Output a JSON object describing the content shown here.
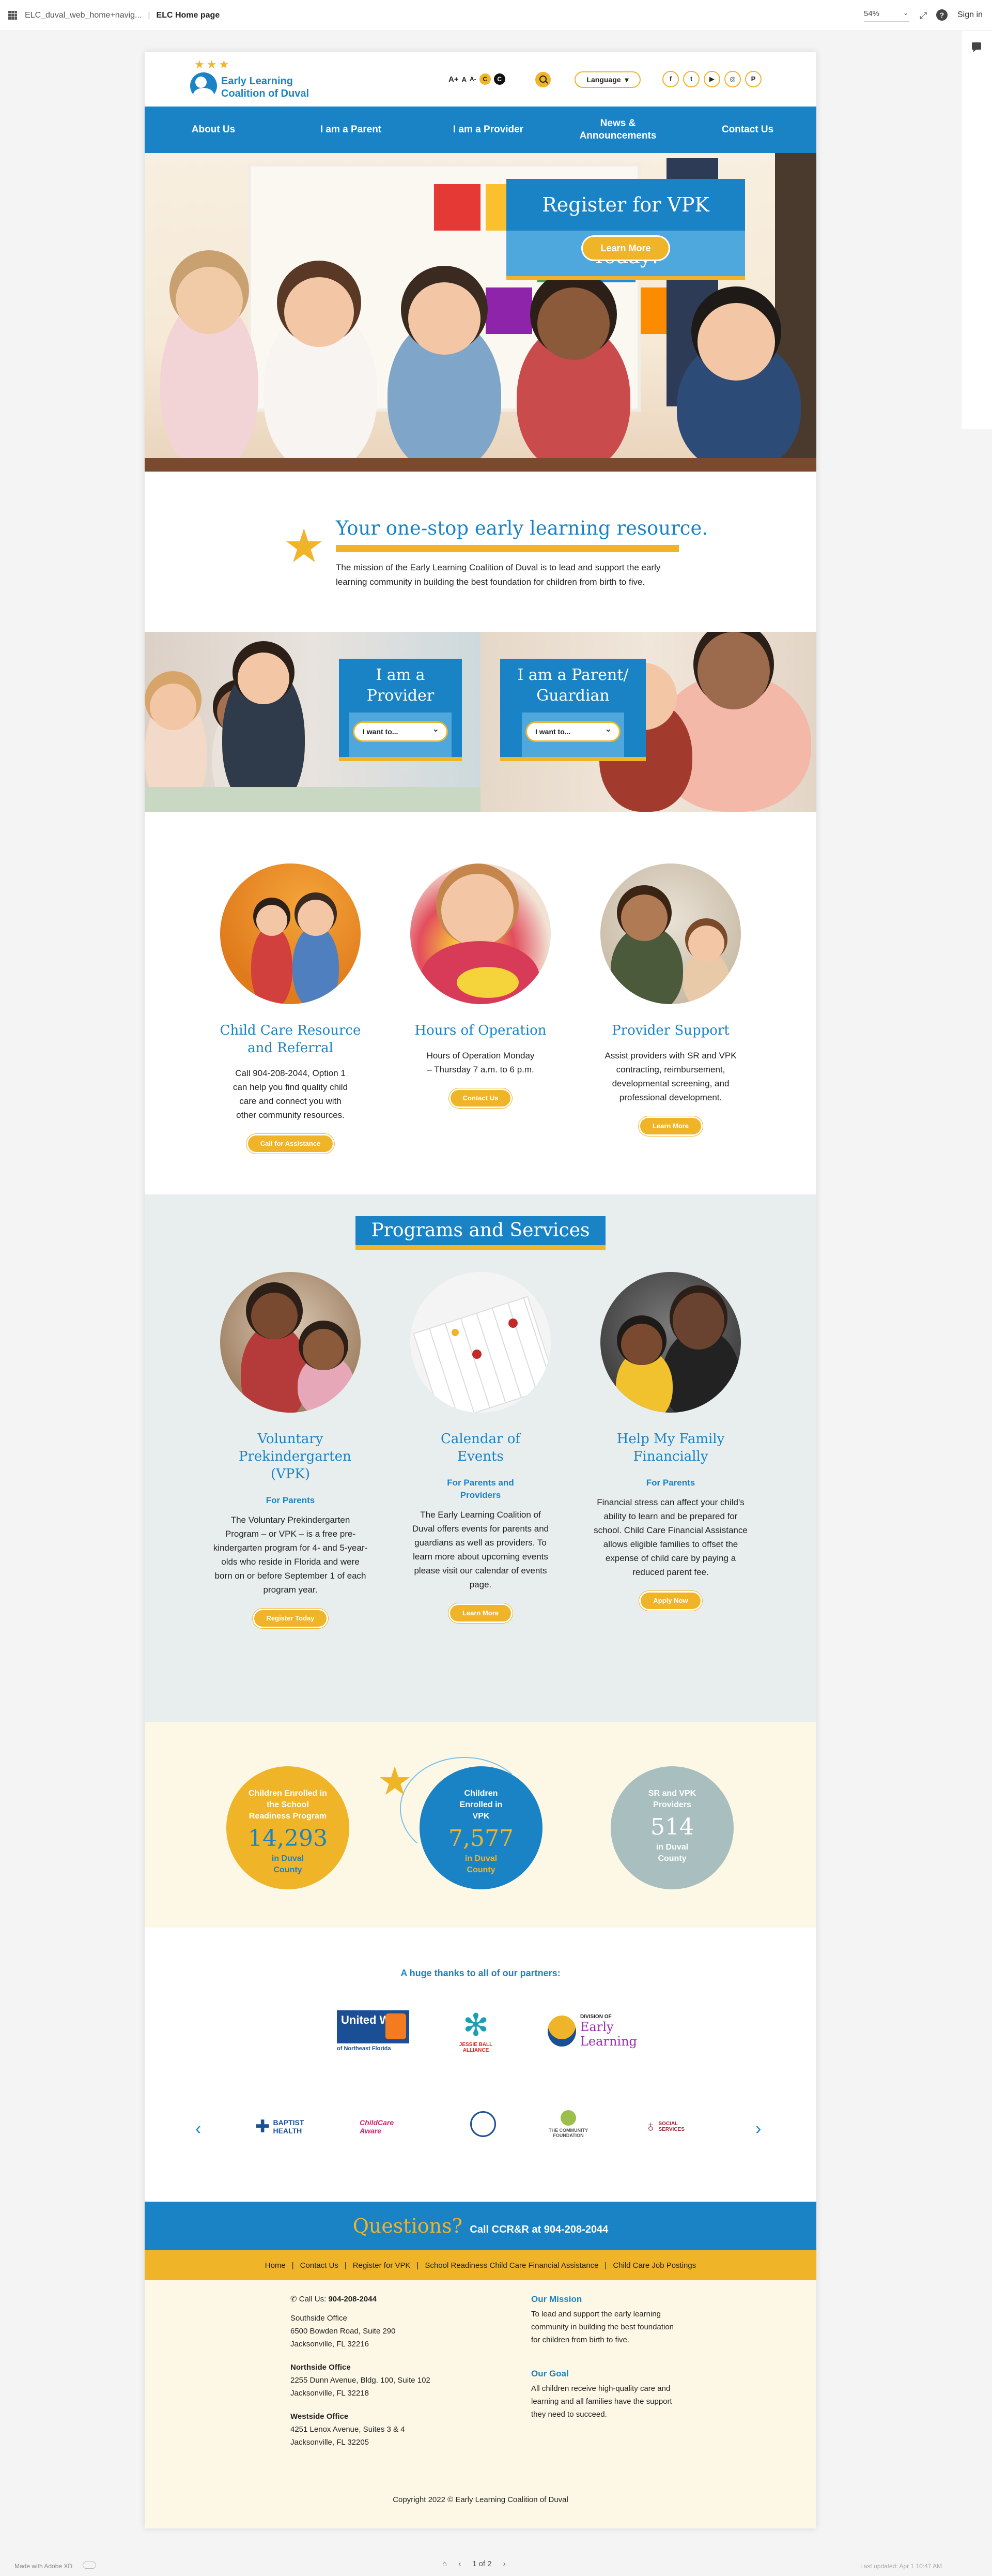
{
  "app": {
    "file_name": "ELC_duval_web_home+navig...",
    "page_name": "ELC Home page",
    "zoom": "54%",
    "sign_in": "Sign in",
    "made_with": "Made with Adobe XD",
    "pager": "1 of 2",
    "last_updated": "Last updated: Apr 1 10:47 AM"
  },
  "header": {
    "logo_line1": "Early Learning",
    "logo_line2": "Coalition of Duval",
    "text_sizes": [
      "A+",
      "A",
      "A-"
    ],
    "contrast": [
      "C",
      "C"
    ],
    "language_label": "Language",
    "social": [
      "f",
      "t",
      "▶",
      "◎",
      "P"
    ]
  },
  "nav": [
    "About Us",
    "I am a Parent",
    "I am a Provider",
    "News & Announcements",
    "Contact Us"
  ],
  "hero": {
    "title": "Register for VPK Today!",
    "button": "Learn More"
  },
  "resource": {
    "title": "Your one-stop early learning resource.",
    "text": "The mission of the Early Learning Coalition of Duval is to lead and support the early learning community in building the best foundation for children from birth to five."
  },
  "audience": {
    "provider_title": "I am a Provider",
    "parent_title": "I am a Parent/ Guardian",
    "select_placeholder": "I want to..."
  },
  "services": [
    {
      "title": "Child Care Resource and Referral",
      "text": "Call 904-208-2044, Option 1 can help you find quality child care and connect you with other community resources.",
      "button": "Call for Assistance"
    },
    {
      "title": "Hours of Operation",
      "text": "Hours of Operation Monday – Thursday 7 a.m. to 6 p.m.",
      "button": "Contact Us"
    },
    {
      "title": "Provider Support",
      "text": "Assist providers with SR and VPK contracting, reimbursement, developmental screening, and professional development.",
      "button": "Learn More"
    }
  ],
  "programs": {
    "title": "Programs and Services",
    "items": [
      {
        "title": "Voluntary Prekindergarten (VPK)",
        "sub": "For Parents",
        "text": "The Voluntary Prekindergarten Program – or VPK – is a free pre-kindergarten program for 4- and 5-year-olds who reside in Florida and were born on or before September 1 of each program year.",
        "button": "Register Today"
      },
      {
        "title": "Calendar of Events",
        "sub": "For Parents and Providers",
        "text": "The Early Learning Coalition of Duval offers events for parents and guardians as well as providers. To learn more about upcoming events please visit our calendar of events page.",
        "button": "Learn More"
      },
      {
        "title": "Help My Family Financially",
        "sub": "For Parents",
        "text": "Financial stress can affect your child's ability to learn and be prepared for school. Child Care Financial Assistance allows eligible families to offset the expense of child care by paying a reduced parent fee.",
        "button": "Apply Now"
      }
    ]
  },
  "stats": [
    {
      "label": "Children Enrolled in the School Readiness Program",
      "value": "14,293",
      "sub": "in Duval County",
      "color": "#f0b429"
    },
    {
      "label": "Children Enrolled in VPK",
      "value": "7,577",
      "sub": "in Duval County",
      "color": "#1a83c6"
    },
    {
      "label": "SR and VPK Providers",
      "value": "514",
      "sub": "in Duval County",
      "color": "#a9bfbf"
    }
  ],
  "partners": {
    "thanks": "A huge thanks to all of our partners:",
    "top": [
      "United Way",
      "of Northeast Florida",
      "JESSIE BALL ALLIANCE",
      "DIVISION OF",
      "Early Learning"
    ],
    "carousel": [
      "BAPTIST HEALTH",
      "ChildCare Aware",
      "THE COMMUNITY FOUNDATION",
      "SOCIAL SERVICES"
    ]
  },
  "questions": {
    "q": "Questions?",
    "call": "Call CCR&R at 904-208-2044"
  },
  "footer_links": [
    "Home",
    "Contact Us",
    "Register for VPK",
    "School Readiness Child Care Financial Assistance",
    "Child Care Job Postings"
  ],
  "footer": {
    "call_label": "Call Us:",
    "call_number": "904-208-2044",
    "offices": [
      {
        "name": "Southside Office",
        "line1": "6500 Bowden Road, Suite 290",
        "line2": "Jacksonville, FL 32216"
      },
      {
        "name": "Northside Office",
        "line1": "2255 Dunn Avenue, Bldg. 100, Suite 102",
        "line2": "Jacksonville, FL 32218"
      },
      {
        "name": "Westside Office",
        "line1": "4251 Lenox Avenue, Suites 3 & 4",
        "line2": "Jacksonville, FL 32205"
      }
    ],
    "mission_title": "Our Mission",
    "mission_text": "To lead and support the early learning community in building the best foundation for children from birth to five.",
    "goal_title": "Our Goal",
    "goal_text": "All children receive high-quality care and learning and all families have the support they need to succeed.",
    "copyright": "Copyright 2022 © Early Learning Coalition of Duval"
  }
}
